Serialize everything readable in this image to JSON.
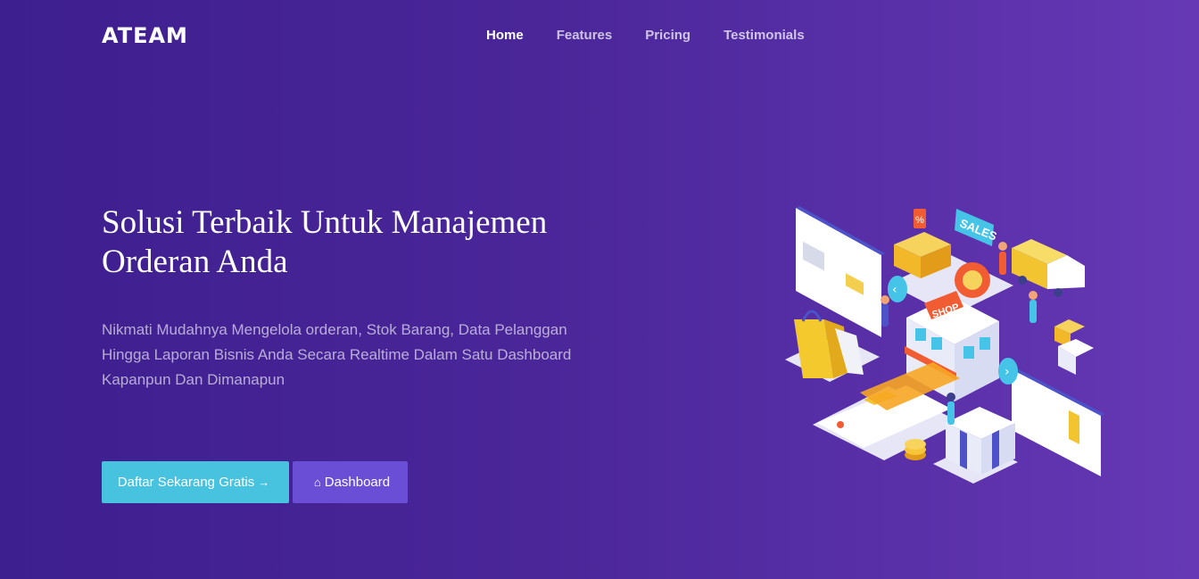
{
  "brand": {
    "logo": "ATEAM"
  },
  "nav": {
    "items": [
      {
        "label": "Home",
        "active": true
      },
      {
        "label": "Features",
        "active": false
      },
      {
        "label": "Pricing",
        "active": false
      },
      {
        "label": "Testimonials",
        "active": false
      }
    ]
  },
  "hero": {
    "title_line1": "Solusi Terbaik Untuk Manajemen",
    "title_line2": "Orderan Anda",
    "description_line1": "Nikmati Mudahnya Mengelola orderan, Stok Barang, Data Pelanggan",
    "description_line2": "Hingga Laporan Bisnis Anda Secara Realtime Dalam Satu Dashboard",
    "description_line3": "Kapanpun Dan Dimanapun",
    "cta_primary": "Daftar Sekarang Gratis",
    "cta_primary_icon": "→",
    "cta_secondary": "Dashboard",
    "cta_secondary_icon": "⌂"
  },
  "illustration": {
    "sales_label": "SALES",
    "shop_label": "SHOP",
    "percent_label": "%"
  },
  "colors": {
    "bg_start": "#3e1f8f",
    "bg_end": "#6638b5",
    "primary_button": "#47c2df",
    "secondary_button": "#6a4fd6"
  }
}
